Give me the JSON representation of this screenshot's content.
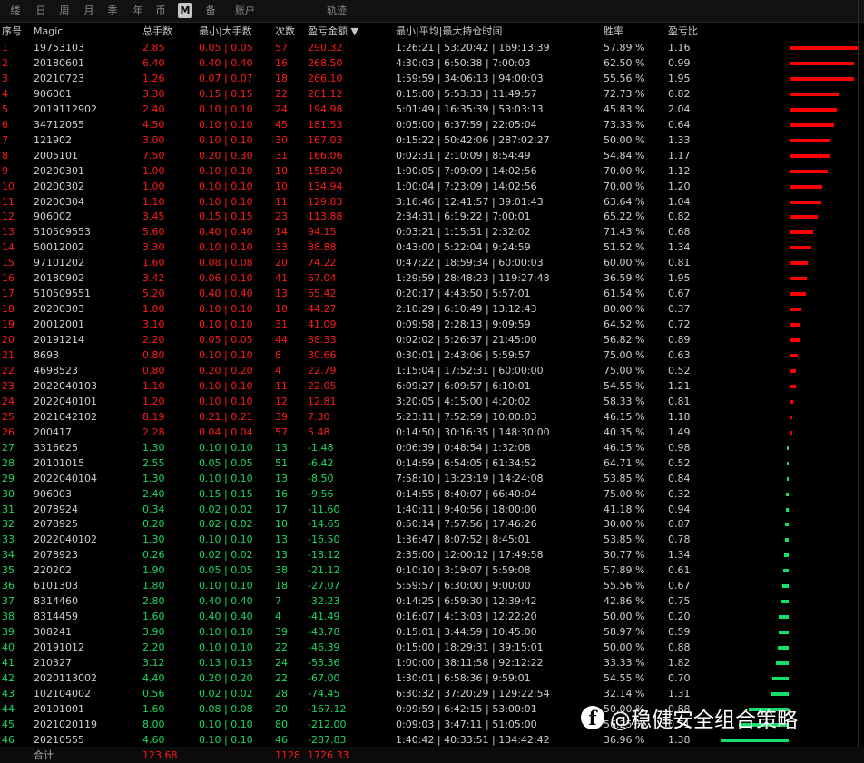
{
  "tabs": [
    {
      "label": "缕"
    },
    {
      "label": "日"
    },
    {
      "label": "周"
    },
    {
      "label": "月"
    },
    {
      "label": "季"
    },
    {
      "label": "年"
    },
    {
      "label": "币"
    },
    {
      "label": "M"
    },
    {
      "label": "备"
    },
    {
      "label": "账户"
    },
    {
      "label": "轨迹"
    }
  ],
  "active_tab": "M",
  "columns": {
    "idx": "序号",
    "magic": "Magic",
    "lots": "总手数",
    "minmax": "最小|大手数",
    "count": "次数",
    "profit": "盈亏金额 ▼",
    "time": "最小|平均|最大持仓时间",
    "win": "胜率",
    "ratio": "盈亏比"
  },
  "rows": [
    [
      "1",
      "19753103",
      "2.85",
      "0.05 | 0.05",
      "57",
      "290.32",
      "1:26:21 | 53:20:42 | 169:13:39",
      "57.89 %",
      "1.16"
    ],
    [
      "2",
      "20180601",
      "6.40",
      "0.40 | 0.40",
      "16",
      "268.50",
      "4:30:03 | 6:50:38 | 7:00:03",
      "62.50 %",
      "0.99"
    ],
    [
      "3",
      "20210723",
      "1.26",
      "0.07 | 0.07",
      "18",
      "266.10",
      "1:59:59 | 34:06:13 | 94:00:03",
      "55.56 %",
      "1.95"
    ],
    [
      "4",
      "906001",
      "3.30",
      "0.15 | 0.15",
      "22",
      "201.12",
      "0:15:00 | 5:53:33 | 11:49:57",
      "72.73 %",
      "0.82"
    ],
    [
      "5",
      "2019112902",
      "2.40",
      "0.10 | 0.10",
      "24",
      "194.98",
      "5:01:49 | 16:35:39 | 53:03:13",
      "45.83 %",
      "2.04"
    ],
    [
      "6",
      "34712055",
      "4.50",
      "0.10 | 0.10",
      "45",
      "181.53",
      "0:05:00 | 6:37:59 | 22:05:04",
      "73.33 %",
      "0.64"
    ],
    [
      "7",
      "121902",
      "3.00",
      "0.10 | 0.10",
      "30",
      "167.03",
      "0:15:22 | 50:42:06 | 287:02:27",
      "50.00 %",
      "1.33"
    ],
    [
      "8",
      "2005101",
      "7.50",
      "0.20 | 0.30",
      "31",
      "166.06",
      "0:02:31 | 2:10:09 | 8:54:49",
      "54.84 %",
      "1.17"
    ],
    [
      "9",
      "20200301",
      "1.00",
      "0.10 | 0.10",
      "10",
      "158.20",
      "1:00:05 | 7:09:09 | 14:02:56",
      "70.00 %",
      "1.12"
    ],
    [
      "10",
      "20200302",
      "1.00",
      "0.10 | 0.10",
      "10",
      "134.94",
      "1:00:04 | 7:23:09 | 14:02:56",
      "70.00 %",
      "1.20"
    ],
    [
      "11",
      "20200304",
      "1.10",
      "0.10 | 0.10",
      "11",
      "129.83",
      "3:16:46 | 12:41:57 | 39:01:43",
      "63.64 %",
      "1.04"
    ],
    [
      "12",
      "906002",
      "3.45",
      "0.15 | 0.15",
      "23",
      "113.88",
      "2:34:31 | 6:19:22 | 7:00:01",
      "65.22 %",
      "0.82"
    ],
    [
      "13",
      "510509553",
      "5.60",
      "0.40 | 0.40",
      "14",
      "94.15",
      "0:03:21 | 1:15:51 | 2:32:02",
      "71.43 %",
      "0.68"
    ],
    [
      "14",
      "50012002",
      "3.30",
      "0.10 | 0.10",
      "33",
      "88.88",
      "0:43:00 | 5:22:04 | 9:24:59",
      "51.52 %",
      "1.34"
    ],
    [
      "15",
      "97101202",
      "1.60",
      "0.08 | 0.08",
      "20",
      "74.22",
      "0:47:22 | 18:59:34 | 60:00:03",
      "60.00 %",
      "0.81"
    ],
    [
      "16",
      "20180902",
      "3.42",
      "0.06 | 0.10",
      "41",
      "67.04",
      "1:29:59 | 28:48:23 | 119:27:48",
      "36.59 %",
      "1.95"
    ],
    [
      "17",
      "510509551",
      "5.20",
      "0.40 | 0.40",
      "13",
      "65.42",
      "0:20:17 | 4:43:50 | 5:57:01",
      "61.54 %",
      "0.67"
    ],
    [
      "18",
      "20200303",
      "1.00",
      "0.10 | 0.10",
      "10",
      "44.27",
      "2:10:29 | 6:10:49 | 13:12:43",
      "80.00 %",
      "0.37"
    ],
    [
      "19",
      "20012001",
      "3.10",
      "0.10 | 0.10",
      "31",
      "41.09",
      "0:09:58 | 2:28:13 | 9:09:59",
      "64.52 %",
      "0.72"
    ],
    [
      "20",
      "20191214",
      "2.20",
      "0.05 | 0.05",
      "44",
      "38.33",
      "0:02:02 | 5:26:37 | 21:45:00",
      "56.82 %",
      "0.89"
    ],
    [
      "21",
      "8693",
      "0.80",
      "0.10 | 0.10",
      "8",
      "30.66",
      "0:30:01 | 2:43:06 | 5:59:57",
      "75.00 %",
      "0.63"
    ],
    [
      "22",
      "4698523",
      "0.80",
      "0.20 | 0.20",
      "4",
      "22.79",
      "1:15:04 | 17:52:31 | 60:00:00",
      "75.00 %",
      "0.52"
    ],
    [
      "23",
      "2022040103",
      "1.10",
      "0.10 | 0.10",
      "11",
      "22.05",
      "6:09:27 | 6:09:57 | 6:10:01",
      "54.55 %",
      "1.21"
    ],
    [
      "24",
      "2022040101",
      "1.20",
      "0.10 | 0.10",
      "12",
      "12.81",
      "3:20:05 | 4:15:00 | 4:20:02",
      "58.33 %",
      "0.81"
    ],
    [
      "25",
      "2021042102",
      "8.19",
      "0.21 | 0.21",
      "39",
      "7.30",
      "5:23:11 | 7:52:59 | 10:00:03",
      "46.15 %",
      "1.18"
    ],
    [
      "26",
      "200417",
      "2.28",
      "0.04 | 0.04",
      "57",
      "5.48",
      "0:14:50 | 30:16:35 | 148:30:00",
      "40.35 %",
      "1.49"
    ],
    [
      "27",
      "3316625",
      "1.30",
      "0.10 | 0.10",
      "13",
      "-1.48",
      "0:06:39 | 0:48:54 | 1:32:08",
      "46.15 %",
      "0.98"
    ],
    [
      "28",
      "20101015",
      "2.55",
      "0.05 | 0.05",
      "51",
      "-6.42",
      "0:14:59 | 6:54:05 | 61:34:52",
      "64.71 %",
      "0.52"
    ],
    [
      "29",
      "2022040104",
      "1.30",
      "0.10 | 0.10",
      "13",
      "-8.50",
      "7:58:10 | 13:23:19 | 14:24:08",
      "53.85 %",
      "0.84"
    ],
    [
      "30",
      "906003",
      "2.40",
      "0.15 | 0.15",
      "16",
      "-9.56",
      "0:14:55 | 8:40:07 | 66:40:04",
      "75.00 %",
      "0.32"
    ],
    [
      "31",
      "2078924",
      "0.34",
      "0.02 | 0.02",
      "17",
      "-11.60",
      "1:40:11 | 9:40:56 | 18:00:00",
      "41.18 %",
      "0.94"
    ],
    [
      "32",
      "2078925",
      "0.20",
      "0.02 | 0.02",
      "10",
      "-14.65",
      "0:50:14 | 7:57:56 | 17:46:26",
      "30.00 %",
      "0.87"
    ],
    [
      "33",
      "2022040102",
      "1.30",
      "0.10 | 0.10",
      "13",
      "-16.50",
      "1:36:47 | 8:07:52 | 8:45:01",
      "53.85 %",
      "0.78"
    ],
    [
      "34",
      "2078923",
      "0.26",
      "0.02 | 0.02",
      "13",
      "-18.12",
      "2:35:00 | 12:00:12 | 17:49:58",
      "30.77 %",
      "1.34"
    ],
    [
      "35",
      "220202",
      "1.90",
      "0.05 | 0.05",
      "38",
      "-21.12",
      "0:10:10 | 3:19:07 | 5:59:08",
      "57.89 %",
      "0.61"
    ],
    [
      "36",
      "6101303",
      "1.80",
      "0.10 | 0.10",
      "18",
      "-27.07",
      "5:59:57 | 6:30:00 | 9:00:00",
      "55.56 %",
      "0.67"
    ],
    [
      "37",
      "8314460",
      "2.80",
      "0.40 | 0.40",
      "7",
      "-32.23",
      "0:14:25 | 6:59:30 | 12:39:42",
      "42.86 %",
      "0.75"
    ],
    [
      "38",
      "8314459",
      "1.60",
      "0.40 | 0.40",
      "4",
      "-41.49",
      "0:16:07 | 4:13:03 | 12:22:20",
      "50.00 %",
      "0.20"
    ],
    [
      "39",
      "308241",
      "3.90",
      "0.10 | 0.10",
      "39",
      "-43.78",
      "0:15:01 | 3:44:59 | 10:45:00",
      "58.97 %",
      "0.59"
    ],
    [
      "40",
      "20191012",
      "2.20",
      "0.10 | 0.10",
      "22",
      "-46.39",
      "0:15:00 | 18:29:31 | 39:15:01",
      "50.00 %",
      "0.88"
    ],
    [
      "41",
      "210327",
      "3.12",
      "0.13 | 0.13",
      "24",
      "-53.36",
      "1:00:00 | 38:11:58 | 92:12:22",
      "33.33 %",
      "1.82"
    ],
    [
      "42",
      "2020113002",
      "4.40",
      "0.20 | 0.20",
      "22",
      "-67.00",
      "1:30:01 | 6:58:36 | 9:59:01",
      "54.55 %",
      "0.70"
    ],
    [
      "43",
      "102104002",
      "0.56",
      "0.02 | 0.02",
      "28",
      "-74.45",
      "6:30:32 | 37:20:29 | 129:22:54",
      "32.14 %",
      "1.31"
    ],
    [
      "44",
      "20101001",
      "1.60",
      "0.08 | 0.08",
      "20",
      "-167.12",
      "0:09:59 | 6:42:15 | 53:00:01",
      "50.00 %",
      "0.88"
    ],
    [
      "45",
      "2021020119",
      "8.00",
      "0.10 | 0.10",
      "80",
      "-212.00",
      "0:09:03 | 3:47:11 | 51:05:00",
      "56.25 %",
      "0.71"
    ],
    [
      "46",
      "20210555",
      "4.60",
      "0.10 | 0.10",
      "46",
      "-287.83",
      "1:40:42 | 40:33:51 | 134:42:42",
      "36.96 %",
      "1.38"
    ]
  ],
  "total": {
    "label": "合计",
    "lots": "123.68",
    "count": "1128",
    "profit": "1726.33"
  },
  "watermark": {
    "icon": "f",
    "text": "@稳健安全组合策略"
  },
  "colors": {
    "positive": "#ff1a1a",
    "negative": "#1ed760",
    "active_tab_bg": "#c8c8c8"
  }
}
